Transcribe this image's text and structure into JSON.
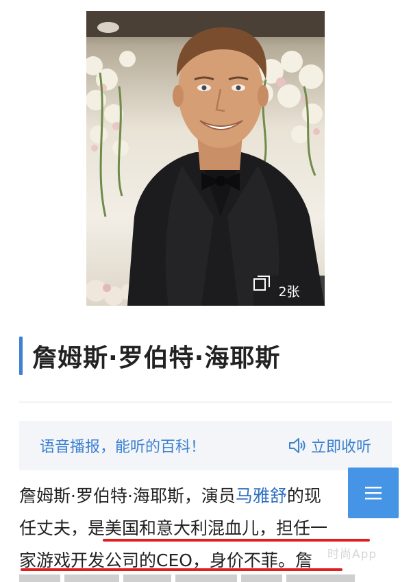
{
  "photo": {
    "count_label": "2张",
    "icon": "gallery-icon"
  },
  "entry": {
    "title": "詹姆斯·罗伯特·海耶斯"
  },
  "audio": {
    "prompt": "语音播报，能听的百科！",
    "listen_label": "立即收听",
    "listen_icon": "speaker-icon"
  },
  "intro": {
    "line1_a": "詹姆斯·罗伯特·海耶斯，演员",
    "line1_link": "马雅舒",
    "line1_b": "的现",
    "line2": "任丈夫，是美国和意大利混血儿，担任一",
    "line3_a": "家游戏开发公司的CEO，身价不菲。",
    "line3_b": "詹"
  },
  "fab": {
    "icon": "menu-icon"
  },
  "watermark": "时尚App",
  "colors": {
    "accent": "#3d81d1",
    "link": "#2f6fc1",
    "fab": "#3d8fe5",
    "annotation": "#e01e1e"
  }
}
